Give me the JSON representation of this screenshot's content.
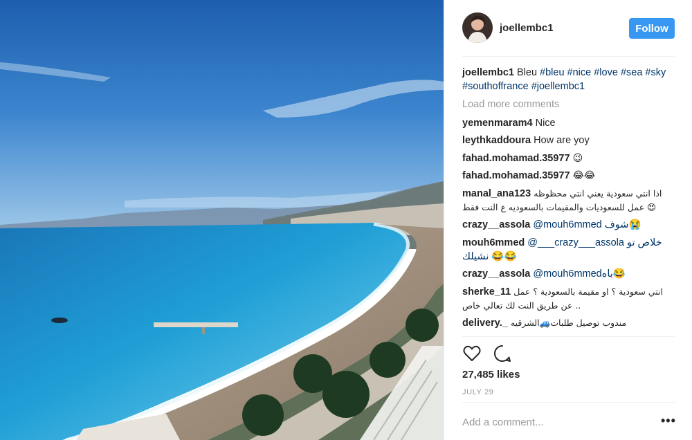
{
  "post": {
    "author": "joellembc1",
    "follow_label": "Follow",
    "caption": {
      "user": "joellembc1",
      "text": "Bleu",
      "tags": "#bleu #nice #love #sea #sky #southoffrance #joellembc1"
    },
    "load_more": "Load more comments",
    "comments": [
      {
        "user": "yemenmaram4",
        "text": "Nice"
      },
      {
        "user": "leythkaddoura",
        "text": "How are yoy"
      },
      {
        "user": "fahad.mohamad.35977",
        "text": "😉"
      },
      {
        "user": "fahad.mohamad.35977",
        "text": "😂😂"
      },
      {
        "user": "manal_ana123",
        "text": "اذا انتي سعودية يعني انتي محظوظه عمل للسعوديات والمقيمات بالسعوديه ع النت فقط 😍"
      },
      {
        "user": "crazy__assola",
        "text": "@mouh6mmed شوف😭"
      },
      {
        "user": "mouh6mmed",
        "text": "@___crazy___assola خلاص تو نشيلك 😂😂"
      },
      {
        "user": "crazy__assola",
        "text": "@mouh6mmedباه😂"
      },
      {
        "user": "sherke_11",
        "text": "انتي سعودية ؟ او مقيمة بالسعودية ؟ عمل عن طريق النت لك تعالي خاص .."
      },
      {
        "user": "delivery._",
        "text": "مندوب توصيل طلبات🚙الشرقيه"
      }
    ],
    "likes": "27,485 likes",
    "date": "JULY 29",
    "add_comment_placeholder": "Add a comment...",
    "more_options": "•••"
  },
  "icons": {
    "like": "heart-icon",
    "comment": "comment-bubble-icon",
    "more": "more-options-icon"
  },
  "colors": {
    "follow_button": "#3897f0",
    "hashtag": "#003569",
    "muted": "#999999",
    "text": "#262626"
  }
}
